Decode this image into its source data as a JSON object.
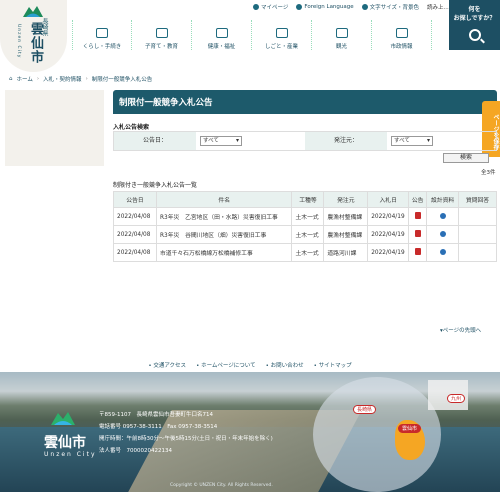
{
  "header": {
    "logo": {
      "pref": "長崎県",
      "city": "雲仙市",
      "romaji": "Unzen City"
    },
    "util": {
      "mypage": "マイページ",
      "foreign": "Foreign Language",
      "textsize": "文字サイズ・背景色",
      "read": "読み上..."
    },
    "nav": [
      "くらし・手続き",
      "子育て・教育",
      "健康・福祉",
      "しごと・産業",
      "観光",
      "市政情報"
    ],
    "search": {
      "line1": "何を",
      "line2": "お探しですか？"
    }
  },
  "breadcrumb": [
    "ホーム",
    "入札・契約情報",
    "制限付一般競争入札公告"
  ],
  "page": {
    "title": "制限付一般競争入札公告",
    "save_label": "ページを保存"
  },
  "search_form": {
    "heading": "入札公告検索",
    "date_label": "公告日：",
    "date_value": "すべて",
    "source_label": "発注元：",
    "source_value": "すべて",
    "submit": "検索",
    "count": "全3件"
  },
  "table": {
    "title": "制限付き一般競争入札公告一覧",
    "headers": [
      "公告日",
      "件名",
      "工種等",
      "発注元",
      "入札日",
      "公告",
      "設計資料",
      "質問回答"
    ],
    "rows": [
      {
        "date": "2022/04/08",
        "name": "R3年災　乙宮地区（田・水路）災害復旧工事",
        "type": "土木一式",
        "source": "農漁村整備課",
        "bid": "2022/04/19"
      },
      {
        "date": "2022/04/08",
        "name": "R3年災　谷間川地区（畑）災害復旧工事",
        "type": "土木一式",
        "source": "農漁村整備課",
        "bid": "2022/04/19"
      },
      {
        "date": "2022/04/08",
        "name": "市道千々石万松橋線万松橋補修工事",
        "type": "土木一式",
        "source": "道路河川課",
        "bid": "2022/04/19"
      }
    ]
  },
  "to_top": "ページの先頭へ",
  "footer_links": [
    "交通アクセス",
    "ホームページについて",
    "お問い合わせ",
    "サイトマップ"
  ],
  "footer": {
    "city": "雲仙市",
    "romaji": "Unzen City",
    "address": "〒859-1107　長崎県雲仙市吾妻町牛口名714",
    "tel": "電話番号 0957-38-3111　Fax 0957-38-3514",
    "hours": "開庁時間：午前8時30分～午後5時15分(土日・祝日・年末年始を除く)",
    "corp": "法人番号　7000020422134",
    "map_labels": {
      "nagasaki": "長崎県",
      "kyushu": "九州",
      "unzen": "雲仙市"
    },
    "copyright": "Copyright © UNZEN City. All Rights Reserved."
  }
}
